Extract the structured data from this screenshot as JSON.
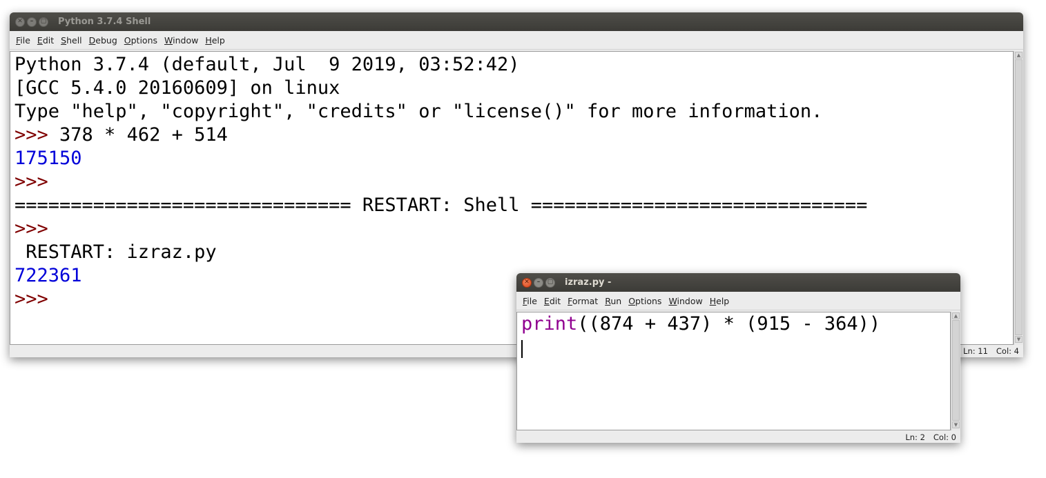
{
  "shell": {
    "title": "Python 3.7.4 Shell",
    "menu": [
      "File",
      "Edit",
      "Shell",
      "Debug",
      "Options",
      "Window",
      "Help"
    ],
    "lines": [
      {
        "kind": "text",
        "text": "Python 3.7.4 (default, Jul  9 2019, 03:52:42)"
      },
      {
        "kind": "text",
        "text": "[GCC 5.4.0 20160609] on linux"
      },
      {
        "kind": "text",
        "text": "Type \"help\", \"copyright\", \"credits\" or \"license()\" for more information."
      },
      {
        "kind": "prompt",
        "prompt": ">>> ",
        "text": "378 * 462 + 514"
      },
      {
        "kind": "output",
        "text": "175150"
      },
      {
        "kind": "prompt",
        "prompt": ">>> ",
        "text": ""
      },
      {
        "kind": "text",
        "text": "============================== RESTART: Shell =============================="
      },
      {
        "kind": "prompt",
        "prompt": ">>> ",
        "text": ""
      },
      {
        "kind": "text",
        "text": " RESTART: izraz.py"
      },
      {
        "kind": "output",
        "text": "722361"
      },
      {
        "kind": "prompt",
        "prompt": ">>> ",
        "text": ""
      }
    ],
    "status": {
      "ln": "Ln: 11",
      "col": "Col: 4"
    }
  },
  "editor": {
    "title": "izraz.py -",
    "menu": [
      "File",
      "Edit",
      "Format",
      "Run",
      "Options",
      "Window",
      "Help"
    ],
    "code_builtin": "print",
    "code_rest": "((874 + 437) * (915 - 364))",
    "status": {
      "ln": "Ln: 2",
      "col": "Col: 0"
    }
  },
  "colors": {
    "prompt": "#7f0000",
    "output": "#0000d9",
    "builtin": "#900090"
  }
}
